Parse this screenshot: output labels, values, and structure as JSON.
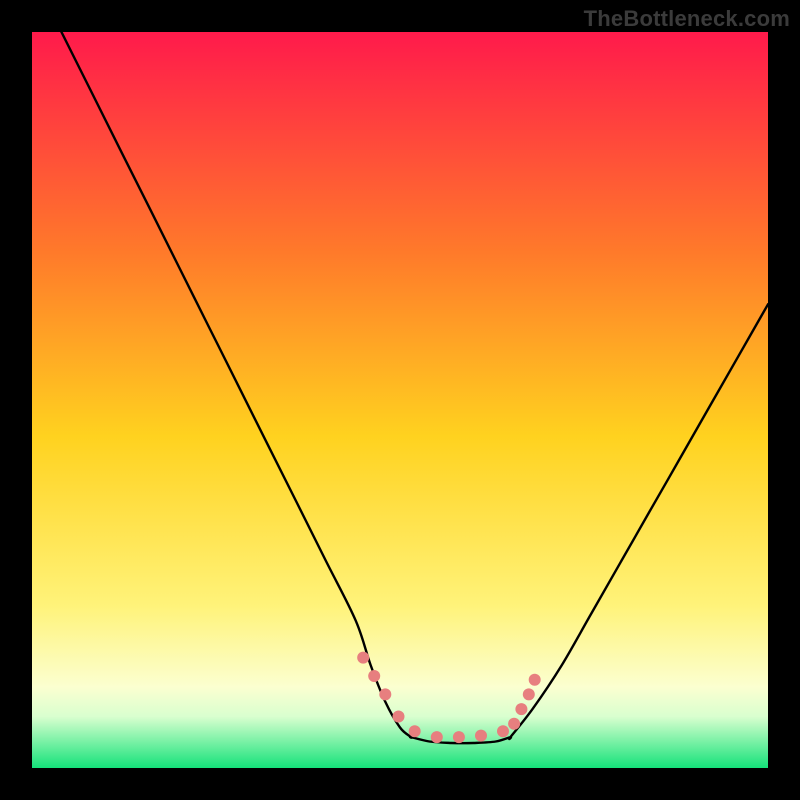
{
  "watermark": "TheBottleneck.com",
  "colors": {
    "frame": "#000000",
    "watermark": "#3b3b3b",
    "gradient_top": "#ff1a4b",
    "gradient_mid_upper": "#ff7a2a",
    "gradient_mid": "#ffd21f",
    "gradient_mid_lower": "#fff37a",
    "gradient_pale": "#fbffd0",
    "gradient_pale2": "#d9ffcf",
    "gradient_bottom": "#15e27a",
    "curve": "#000000",
    "markers": "#e77f7f"
  },
  "chart_data": {
    "type": "line",
    "title": "",
    "xlabel": "",
    "ylabel": "",
    "xlim": [
      0,
      100
    ],
    "ylim": [
      0,
      100
    ],
    "series": [
      {
        "name": "left-branch",
        "x": [
          4,
          8,
          12,
          16,
          20,
          24,
          28,
          32,
          36,
          40,
          44,
          46,
          48,
          50,
          51.5
        ],
        "y": [
          100,
          92,
          84,
          76,
          68,
          60,
          52,
          44,
          36,
          28,
          20,
          14,
          9,
          5.5,
          4.2
        ]
      },
      {
        "name": "floor",
        "x": [
          51.5,
          54,
          57,
          60,
          63,
          65
        ],
        "y": [
          4.2,
          3.6,
          3.4,
          3.4,
          3.6,
          4.2
        ]
      },
      {
        "name": "right-branch",
        "x": [
          65,
          68,
          72,
          76,
          80,
          84,
          88,
          92,
          96,
          100
        ],
        "y": [
          4.2,
          8,
          14,
          21,
          28,
          35,
          42,
          49,
          56,
          63
        ]
      }
    ],
    "markers": {
      "name": "marker-points",
      "points": [
        {
          "x": 45.0,
          "y": 15.0
        },
        {
          "x": 46.5,
          "y": 12.5
        },
        {
          "x": 48.0,
          "y": 10.0
        },
        {
          "x": 49.8,
          "y": 7.0
        },
        {
          "x": 52.0,
          "y": 5.0
        },
        {
          "x": 55.0,
          "y": 4.2
        },
        {
          "x": 58.0,
          "y": 4.2
        },
        {
          "x": 61.0,
          "y": 4.4
        },
        {
          "x": 64.0,
          "y": 5.0
        },
        {
          "x": 65.5,
          "y": 6.0
        },
        {
          "x": 66.5,
          "y": 8.0
        },
        {
          "x": 67.5,
          "y": 10.0
        },
        {
          "x": 68.3,
          "y": 12.0
        }
      ]
    }
  }
}
